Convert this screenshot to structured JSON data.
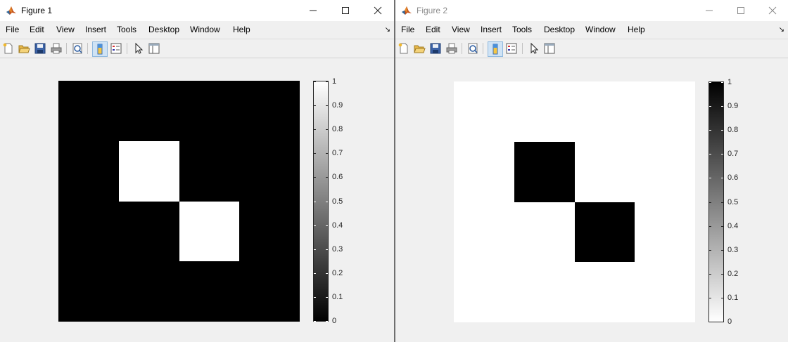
{
  "menu": [
    "File",
    "Edit",
    "View",
    "Insert",
    "Tools",
    "Desktop",
    "Window",
    "Help"
  ],
  "colors": {
    "titlebar_bg": "#ffffff",
    "chrome_bg": "#f0f0f0",
    "inactive_title": "#8a8a8a",
    "toolbar_active": "#cfe3f5"
  },
  "toolbar_icons": [
    "new-figure-icon",
    "open-file-icon",
    "save-icon",
    "print-icon",
    "print-preview-icon",
    "colorbar-toggle-icon",
    "legend-toggle-icon",
    "pointer-icon",
    "property-editor-icon"
  ],
  "figures": [
    {
      "title": "Figure 1",
      "window_active": true,
      "colormap": "gray",
      "chart_data": {
        "type": "heatmap",
        "rows": 4,
        "cols": 4,
        "values": [
          [
            0,
            0,
            0,
            0
          ],
          [
            0,
            1,
            0,
            0
          ],
          [
            0,
            0,
            1,
            0
          ],
          [
            0,
            0,
            0,
            0
          ]
        ],
        "clim": [
          0,
          1
        ],
        "colorbar_ticks": [
          "0",
          "0.1",
          "0.2",
          "0.3",
          "0.4",
          "0.5",
          "0.6",
          "0.7",
          "0.8",
          "0.9",
          "1"
        ]
      }
    },
    {
      "title": "Figure 2",
      "window_active": false,
      "colormap": "gray-inverted",
      "chart_data": {
        "type": "heatmap",
        "rows": 4,
        "cols": 4,
        "values": [
          [
            0,
            0,
            0,
            0
          ],
          [
            0,
            1,
            0,
            0
          ],
          [
            0,
            0,
            1,
            0
          ],
          [
            0,
            0,
            0,
            0
          ]
        ],
        "clim": [
          0,
          1
        ],
        "colorbar_ticks": [
          "0",
          "0.1",
          "0.2",
          "0.3",
          "0.4",
          "0.5",
          "0.6",
          "0.7",
          "0.8",
          "0.9",
          "1"
        ]
      }
    }
  ]
}
